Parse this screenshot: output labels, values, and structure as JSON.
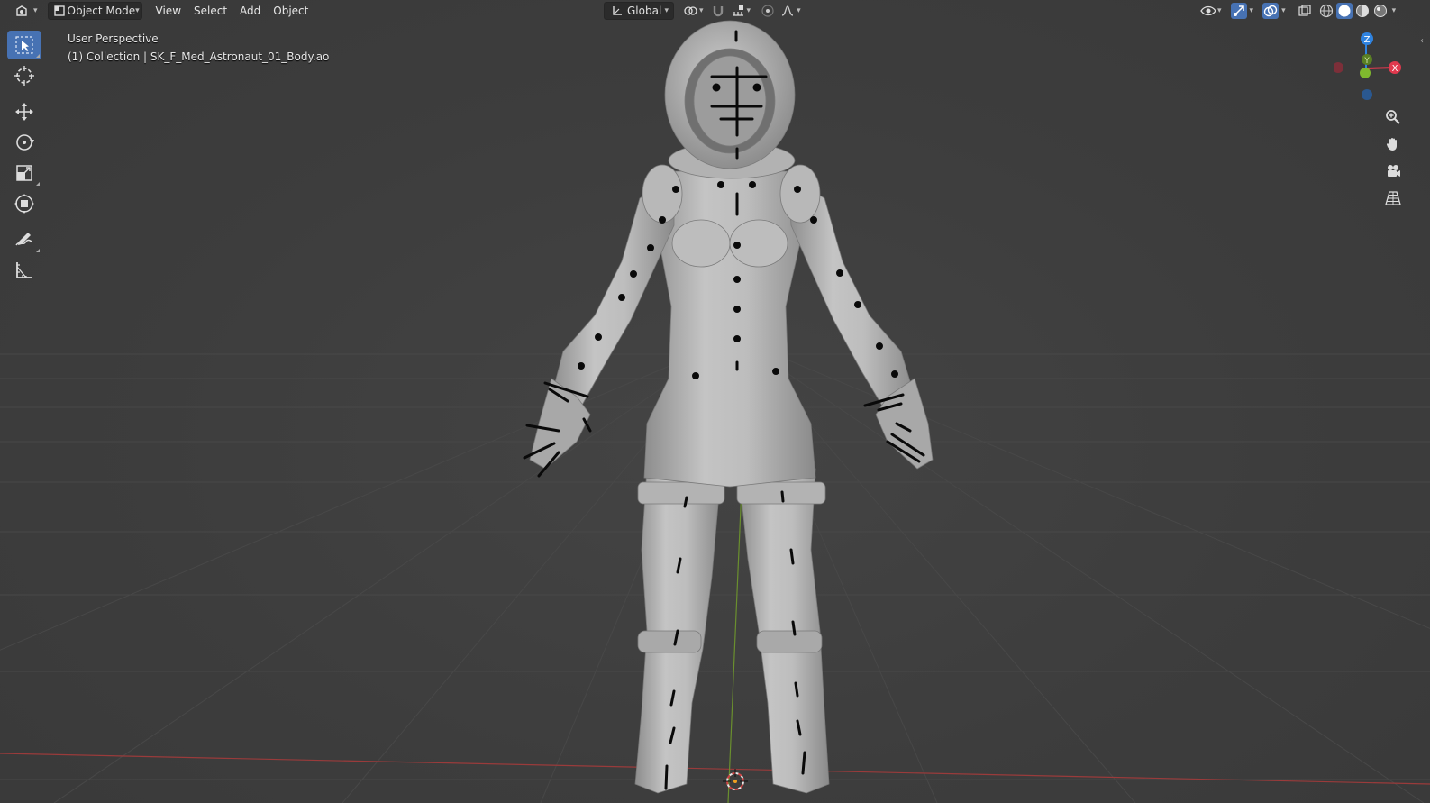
{
  "header": {
    "editor_type_icon": "editor-type-icon",
    "mode": {
      "label": "Object Mode",
      "icon": "object-mode-icon"
    },
    "menus": [
      "View",
      "Select",
      "Add",
      "Object"
    ],
    "transform_orientation": {
      "label": "Global",
      "icon": "orientation-icon"
    },
    "pivot_icon": "pivot-icon",
    "snap_icon": "magnet-icon",
    "snap_target_icon": "snap-increment-icon",
    "proportional_icon": "proportional-editing-icon",
    "falloff_icon": "falloff-curve-icon",
    "right_icons": [
      "visibility-icon",
      "gizmo-icon",
      "overlays-icon",
      "xray-icon",
      "wireframe-shading-icon",
      "solid-shading-icon",
      "material-shading-icon",
      "rendered-shading-icon"
    ]
  },
  "toolbar": {
    "tools": [
      "select-box-tool",
      "cursor-tool",
      "move-tool",
      "rotate-tool",
      "scale-tool",
      "transform-tool",
      "annotate-tool",
      "measure-tool"
    ],
    "active": "select-box-tool"
  },
  "viewport": {
    "perspective_label": "User Perspective",
    "collection_label": "(1) Collection | SK_F_Med_Astronaut_01_Body.ao"
  },
  "navigation": {
    "gizmo_axes": [
      "Z",
      "X",
      "Y"
    ],
    "axis_colors": {
      "x": "#e0394e",
      "y": "#7fb82e",
      "z": "#2f83e0"
    },
    "buttons": [
      "zoom-icon",
      "hand-pan-icon",
      "camera-icon",
      "perspective-grid-icon"
    ]
  },
  "colors": {
    "header_bg": "#303030",
    "viewport_bg": "#3d3d3d",
    "active_tool": "#4772b3",
    "grid_line": "#474747",
    "x_axis_line": "#9a3b3b",
    "y_axis_line": "#6a8f2e",
    "model": "#b5b5b5"
  }
}
